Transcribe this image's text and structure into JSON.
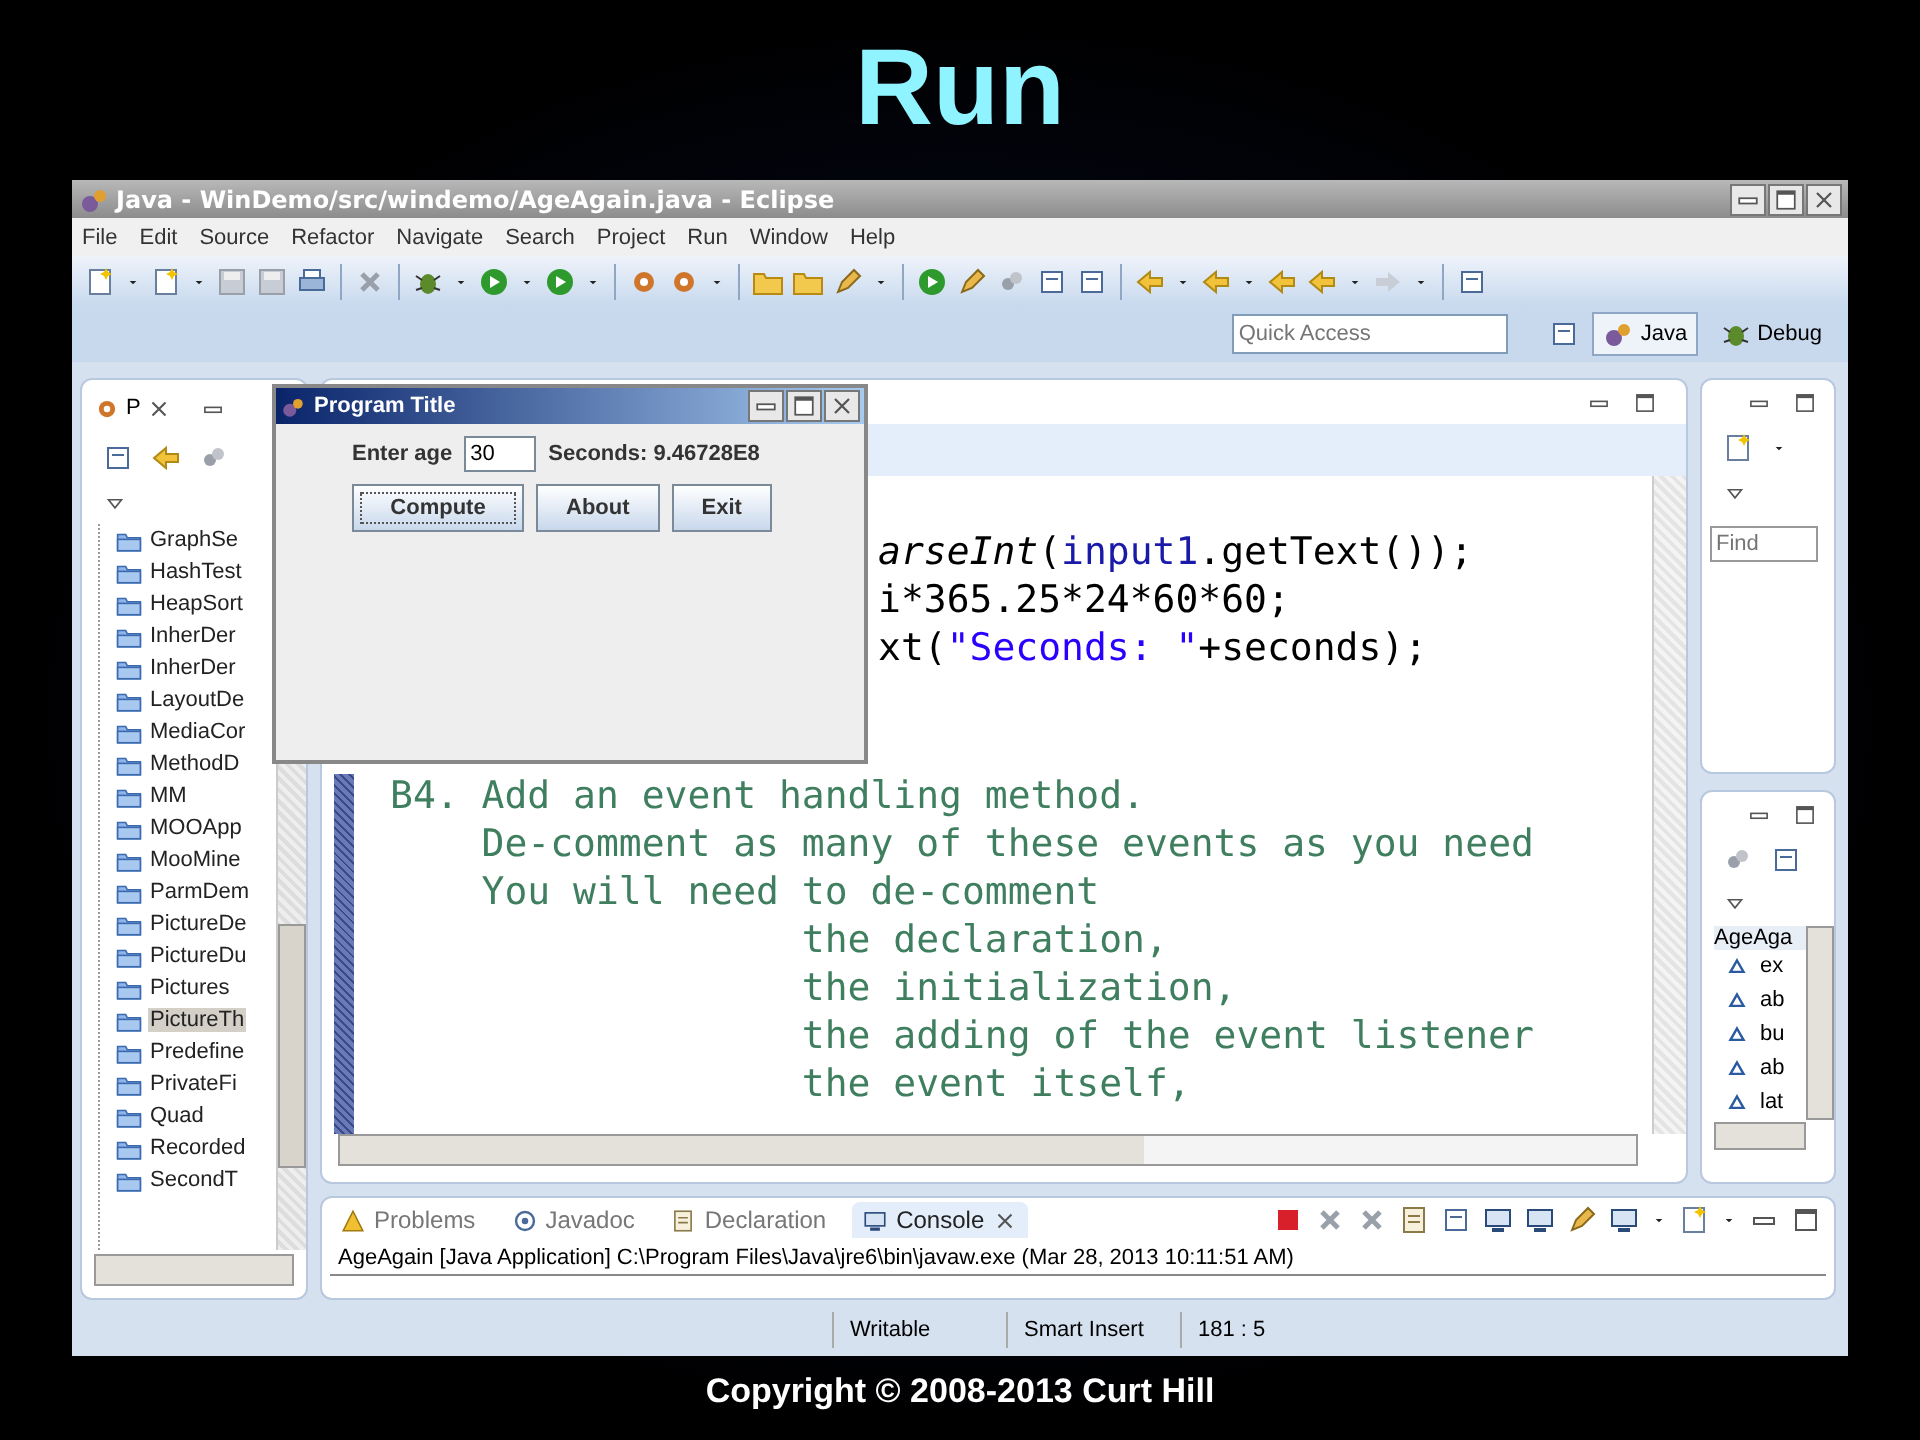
{
  "slide_title": "Run",
  "window": {
    "title": "Java - WinDemo/src/windemo/AgeAgain.java - Eclipse"
  },
  "menu": [
    "File",
    "Edit",
    "Source",
    "Refactor",
    "Navigate",
    "Search",
    "Project",
    "Run",
    "Window",
    "Help"
  ],
  "quick_access": {
    "placeholder": "Quick Access"
  },
  "perspectives": [
    {
      "label": "Java",
      "kind": "java",
      "selected": true
    },
    {
      "label": "Debug",
      "kind": "debug",
      "selected": false
    }
  ],
  "package_explorer": {
    "tab": "P",
    "items": [
      {
        "label": "GraphSe",
        "selected": false
      },
      {
        "label": "HashTest",
        "selected": false
      },
      {
        "label": "HeapSort",
        "selected": false
      },
      {
        "label": "InherDer",
        "selected": false
      },
      {
        "label": "InherDer",
        "selected": false
      },
      {
        "label": "LayoutDe",
        "selected": false
      },
      {
        "label": "MediaCor",
        "selected": false
      },
      {
        "label": "MethodD",
        "selected": false
      },
      {
        "label": "MM",
        "selected": false
      },
      {
        "label": "MOOApp",
        "selected": false
      },
      {
        "label": "MooMine",
        "selected": false
      },
      {
        "label": "ParmDem",
        "selected": false
      },
      {
        "label": "PictureDe",
        "selected": false
      },
      {
        "label": "PictureDu",
        "selected": false
      },
      {
        "label": "Pictures",
        "selected": false
      },
      {
        "label": "PictureTh",
        "selected": true
      },
      {
        "label": "Predefine",
        "selected": false
      },
      {
        "label": "PrivateFi",
        "selected": false
      },
      {
        "label": "Quad",
        "selected": false
      },
      {
        "label": "Recorded",
        "selected": false
      },
      {
        "label": "SecondT",
        "selected": false
      }
    ]
  },
  "editor": {
    "lines": [
      {
        "kind": "code",
        "tokens": [
          {
            "text": "arseInt",
            "kind": "method"
          },
          {
            "text": "(",
            "kind": "plain"
          },
          {
            "text": "input1",
            "kind": "field"
          },
          {
            "text": ".getText());",
            "kind": "plain"
          }
        ]
      },
      {
        "kind": "code",
        "tokens": [
          {
            "text": "i*365.25*24*60*60;",
            "kind": "plain"
          }
        ]
      },
      {
        "kind": "code",
        "tokens": [
          {
            "text": "xt(",
            "kind": "plain"
          },
          {
            "text": "\"Seconds: \"",
            "kind": "string"
          },
          {
            "text": "+seconds);",
            "kind": "plain"
          }
        ]
      },
      {
        "kind": "heading",
        "text": "B4. Add an event handling method."
      },
      {
        "kind": "body",
        "text": "De-comment as many of these events as you need"
      },
      {
        "kind": "body",
        "text": "You will need to de-comment"
      },
      {
        "kind": "item",
        "text": "the declaration,"
      },
      {
        "kind": "item",
        "text": "the initialization,"
      },
      {
        "kind": "item",
        "text": "the adding of the event listener"
      },
      {
        "kind": "item",
        "text": "the event itself,"
      }
    ]
  },
  "find_field": {
    "placeholder": "Find"
  },
  "outline": {
    "header": "AgeAga",
    "items": [
      "ex",
      "ab",
      "bu",
      "ab",
      "lat"
    ]
  },
  "console": {
    "tabs": [
      {
        "label": "Problems",
        "kind": "problems",
        "selected": false
      },
      {
        "label": "Javadoc",
        "kind": "javadoc",
        "selected": false
      },
      {
        "label": "Declaration",
        "kind": "declaration",
        "selected": false
      },
      {
        "label": "Console",
        "kind": "console",
        "selected": true
      }
    ],
    "line": "AgeAgain [Java Application] C:\\Program Files\\Java\\jre6\\bin\\javaw.exe (Mar 28, 2013 10:11:51 AM)"
  },
  "status_bar": [
    "Writable",
    "Smart Insert",
    "181 : 5"
  ],
  "dialog": {
    "title": "Program Title",
    "age_label": "Enter age",
    "age_value": "30",
    "result": "Seconds: 9.46728E8",
    "buttons": [
      {
        "label": "Compute",
        "focused": true
      },
      {
        "label": "About",
        "focused": false
      },
      {
        "label": "Exit",
        "focused": false
      }
    ]
  },
  "footer": "Copyright © 2008-2013 Curt Hill"
}
